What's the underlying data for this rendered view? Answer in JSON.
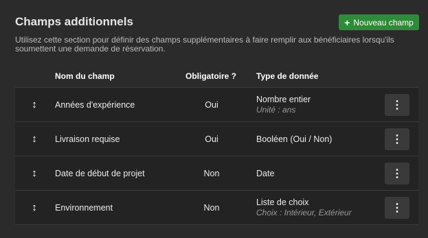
{
  "header": {
    "title": "Champs additionnels",
    "new_button_label": "Nouveau champ",
    "new_button_icon": "plus-icon",
    "description": "Utilisez cette section pour définir des champs supplémentaires à faire remplir aux bénéficiaires lorsqu'ils soumettent une demande de réservation."
  },
  "table": {
    "columns": [
      "Nom du champ",
      "Obligatoire ?",
      "Type de donnée"
    ],
    "rows": [
      {
        "name": "Années d'expérience",
        "required": "Oui",
        "type": "Nombre entier",
        "type_detail": "Unité : ans"
      },
      {
        "name": "Livraison requise",
        "required": "Oui",
        "type": "Booléen (Oui / Non)",
        "type_detail": ""
      },
      {
        "name": "Date de début de projet",
        "required": "Non",
        "type": "Date",
        "type_detail": ""
      },
      {
        "name": "Environnement",
        "required": "Non",
        "type": "Liste de choix",
        "type_detail": "Choix : Intérieur, Extérieur"
      }
    ]
  },
  "icons": {
    "drag": "drag-handle-icon",
    "menu": "kebab-menu-icon"
  },
  "colors": {
    "background": "#2b2b2b",
    "row_background": "#232323",
    "accent_green": "#2e8b3a"
  }
}
